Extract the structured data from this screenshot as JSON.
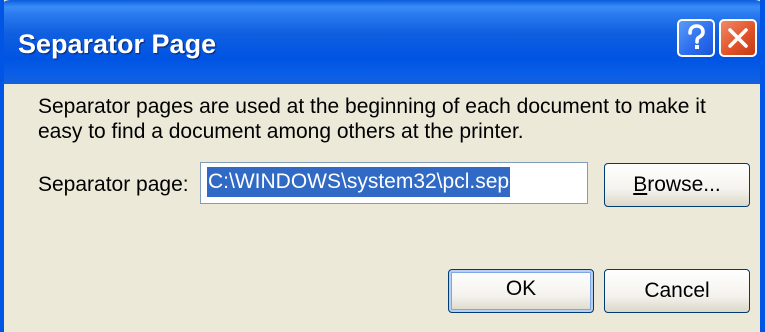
{
  "dialog": {
    "title": "Separator Page",
    "description": "Separator pages are used at the beginning of each document to make it easy to find a document among others at the printer.",
    "field_label": "Separator page:",
    "field_value": "C:\\WINDOWS\\system32\\pcl.sep",
    "browse": {
      "accel": "B",
      "rest": "rowse..."
    },
    "ok_label": "OK",
    "cancel_label": "Cancel"
  },
  "icons": {
    "help": "help-question-icon",
    "close": "close-x-icon"
  },
  "colors": {
    "titlebar": "#0054e3",
    "window_face": "#ece9d8",
    "selection": "#316ac5",
    "close_button": "#e2542a"
  }
}
